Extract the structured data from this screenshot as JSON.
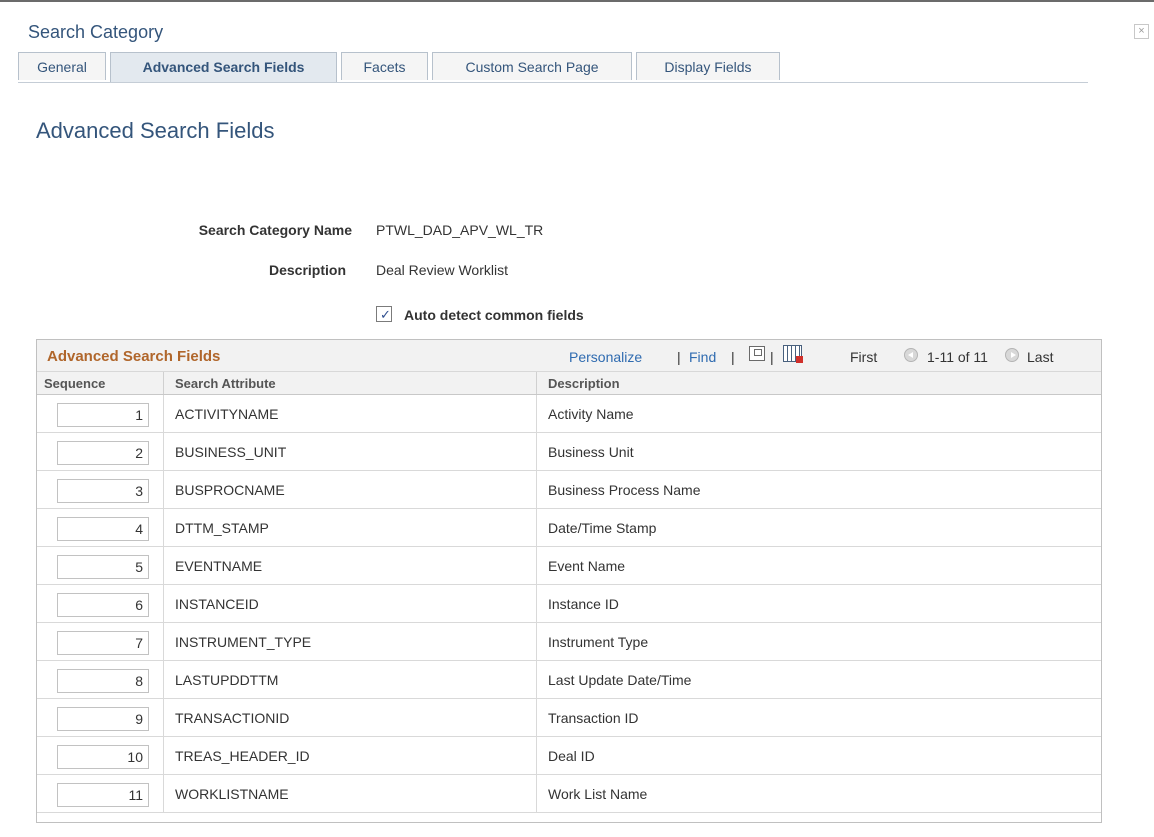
{
  "window": {
    "title": "Search Category",
    "close_glyph": "×"
  },
  "tabs": [
    {
      "label": "General",
      "active": false
    },
    {
      "label": "Advanced Search Fields",
      "active": true
    },
    {
      "label": "Facets",
      "active": false
    },
    {
      "label": "Custom Search Page",
      "active": false
    },
    {
      "label": "Display Fields",
      "active": false
    }
  ],
  "page_title": "Advanced Search Fields",
  "form": {
    "category_name_label": "Search Category Name",
    "category_name_value": "PTWL_DAD_APV_WL_TR",
    "description_label": "Description",
    "description_value": "Deal Review Worklist",
    "auto_detect_label": "Auto detect common fields",
    "auto_detect_checked": true,
    "checkmark_glyph": "✓"
  },
  "grid": {
    "title": "Advanced Search Fields",
    "personalize": "Personalize",
    "sep1": "|",
    "find": "Find",
    "sep2": "|",
    "sep3": "|",
    "first": "First",
    "range": "1-11 of 11",
    "last": "Last",
    "columns": {
      "sequence": "Sequence",
      "search_attribute": "Search Attribute",
      "description": "Description"
    },
    "rows": [
      {
        "sequence": "1",
        "attribute": "ACTIVITYNAME",
        "description": "Activity Name"
      },
      {
        "sequence": "2",
        "attribute": "BUSINESS_UNIT",
        "description": "Business Unit"
      },
      {
        "sequence": "3",
        "attribute": "BUSPROCNAME",
        "description": "Business Process Name"
      },
      {
        "sequence": "4",
        "attribute": "DTTM_STAMP",
        "description": "Date/Time Stamp"
      },
      {
        "sequence": "5",
        "attribute": "EVENTNAME",
        "description": "Event Name"
      },
      {
        "sequence": "6",
        "attribute": "INSTANCEID",
        "description": "Instance ID"
      },
      {
        "sequence": "7",
        "attribute": "INSTRUMENT_TYPE",
        "description": "Instrument Type"
      },
      {
        "sequence": "8",
        "attribute": "LASTUPDDTTM",
        "description": "Last Update Date/Time"
      },
      {
        "sequence": "9",
        "attribute": "TRANSACTIONID",
        "description": "Transaction ID"
      },
      {
        "sequence": "10",
        "attribute": "TREAS_HEADER_ID",
        "description": "Deal ID"
      },
      {
        "sequence": "11",
        "attribute": "WORKLISTNAME",
        "description": "Work List Name"
      }
    ]
  },
  "colors": {
    "title_blue": "#34557b",
    "grid_title_orange": "#b0662b",
    "link_blue": "#2f6bb0"
  },
  "icons": [
    "close-icon",
    "view-all-icon",
    "download-grid-icon",
    "previous-arrow-icon",
    "next-arrow-icon",
    "checkbox-check-icon"
  ]
}
